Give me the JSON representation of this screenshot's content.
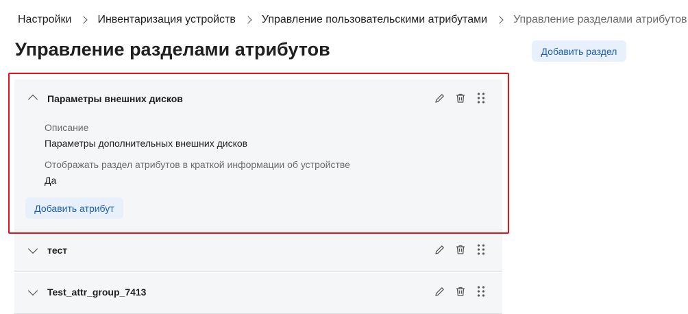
{
  "breadcrumb": {
    "items": [
      "Настройки",
      "Инвентаризация устройств",
      "Управление пользовательскими атрибутами",
      "Управление разделами атрибутов"
    ]
  },
  "page": {
    "title": "Управление разделами атрибутов",
    "add_section_label": "Добавить раздел"
  },
  "sections": [
    {
      "title": "Параметры внешних дисков",
      "expanded": true,
      "description_label": "Описание",
      "description_value": "Параметры дополнительных внешних дисков",
      "show_label": "Отображать раздел атрибутов в краткой информации об устройстве",
      "show_value": "Да",
      "add_attribute_label": "Добавить атрибут"
    },
    {
      "title": "тест",
      "expanded": false
    },
    {
      "title": "Test_attr_group_7413",
      "expanded": false
    }
  ],
  "icons": {
    "edit": "pencil-icon",
    "delete": "trash-icon",
    "drag": "drag-handle-icon"
  },
  "colors": {
    "accent": "#1a5fb4",
    "button_bg": "#e8f0fb",
    "section_bg": "#f5f6f8",
    "highlight": "#e8121b"
  }
}
